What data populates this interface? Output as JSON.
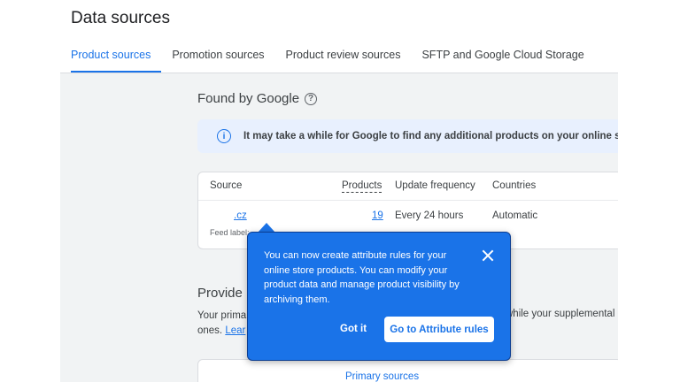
{
  "header": {
    "title": "Data sources"
  },
  "tabs": [
    {
      "label": "Product sources",
      "active": true
    },
    {
      "label": "Promotion sources",
      "active": false
    },
    {
      "label": "Product review sources",
      "active": false
    },
    {
      "label": "SFTP and Google Cloud Storage",
      "active": false
    }
  ],
  "found_by_google": {
    "title": "Found by Google",
    "help_icon": "help-circle-icon",
    "info_icon": "info-icon",
    "info_text": "It may take a while for Google to find any additional products on your online store",
    "table": {
      "columns": [
        "Source",
        "Products",
        "Update frequency",
        "Countries"
      ],
      "rows": [
        {
          "source": ".cz",
          "feed_label": "Feed label:",
          "products": "19",
          "frequency": "Every 24 hours",
          "countries": "Automatic"
        }
      ]
    }
  },
  "provided": {
    "title": "Provide",
    "text_line1": "Your prima",
    "text_line2_prefix": "ones. ",
    "text_line2_link": "Lear",
    "text_right": "while your supplemental",
    "primary_sources_label": "Primary sources"
  },
  "popover": {
    "text": "You can now create attribute rules for your online store products. You can modify your product data and manage product visibility by archiving them.",
    "close_icon": "close-icon",
    "got_it": "Got it",
    "go_to": "Go to Attribute rules"
  },
  "colors": {
    "accent": "#1a73e8",
    "banner_bg": "#e8f0fe",
    "page_bg": "#f1f3f4"
  }
}
